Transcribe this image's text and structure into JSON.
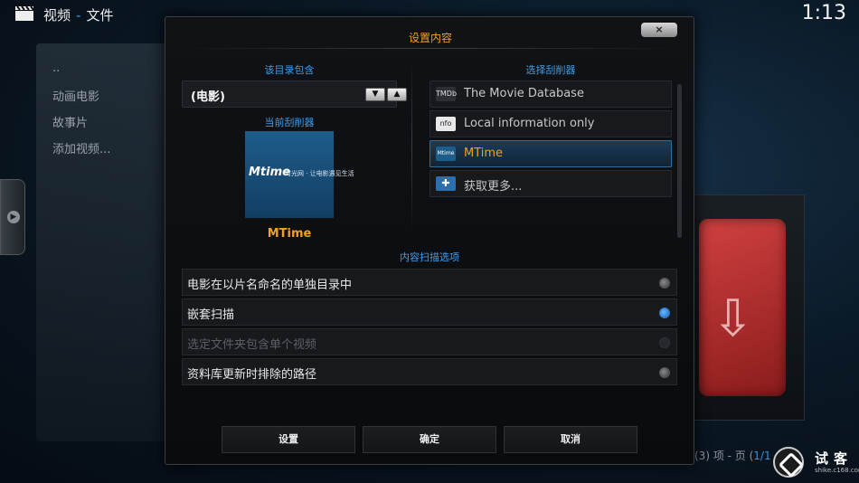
{
  "header": {
    "app_icon": "clapperboard-icon",
    "breadcrumb_root": "视频",
    "breadcrumb_sep": "-",
    "breadcrumb_current": "文件",
    "clock": "1:13"
  },
  "background": {
    "file_list": [
      "..",
      "动画电影",
      "故事片",
      "添加视频..."
    ],
    "page_info_prefix": "(3) 项 - 页 (",
    "page_info_highlight": "1/1",
    "watermark_title": "试客",
    "watermark_sub": "shike.c168.com"
  },
  "dialog": {
    "title": "设置内容",
    "close_label": "×",
    "dir_contains_label": "该目录包含",
    "content_type_value": "(电影)",
    "current_scraper_label": "当前刮削器",
    "current_scraper_logo": "Mtime",
    "current_scraper_tagline": "时光网 · 让电影遇见生活",
    "current_scraper_name": "MTime",
    "select_scraper_label": "选择刮削器",
    "scrapers": [
      {
        "label": "The Movie Database",
        "icon": "tmdb-icon",
        "icon_text": "TMDb",
        "selected": false
      },
      {
        "label": "Local information only",
        "icon": "nfo-icon",
        "icon_text": "nfo",
        "selected": false
      },
      {
        "label": "MTime",
        "icon": "mtime-icon",
        "icon_text": "Mtime",
        "selected": true
      },
      {
        "label": "获取更多...",
        "icon": "puzzle-icon",
        "icon_text": "✚",
        "selected": false
      }
    ],
    "scan_options_label": "内容扫描选项",
    "options": [
      {
        "label": "电影在以片名命名的单独目录中",
        "state": "off"
      },
      {
        "label": "嵌套扫描",
        "state": "on"
      },
      {
        "label": "选定文件夹包含单个视频",
        "state": "disabled"
      },
      {
        "label": "资料库更新时排除的路径",
        "state": "off"
      }
    ],
    "buttons": {
      "settings": "设置",
      "ok": "确定",
      "cancel": "取消"
    }
  },
  "colors": {
    "accent_orange": "#f0a028",
    "accent_blue": "#3f9de8",
    "radio_on": "#1d62b8"
  }
}
